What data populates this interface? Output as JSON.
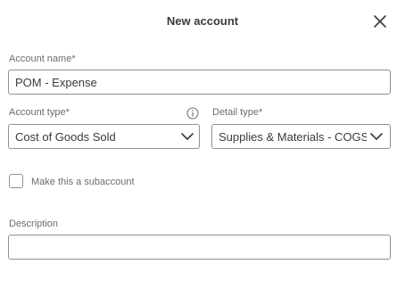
{
  "dialog": {
    "title": "New account"
  },
  "account_name": {
    "label": "Account name*",
    "value": "POM - Expense"
  },
  "account_type": {
    "label": "Account type*",
    "value": "Cost of Goods Sold"
  },
  "detail_type": {
    "label": "Detail type*",
    "value": "Supplies & Materials - COGS"
  },
  "subaccount": {
    "label": "Make this a subaccount",
    "checked": false
  },
  "description": {
    "label": "Description",
    "value": ""
  },
  "icons": {
    "close": "close-icon",
    "info": "info-icon",
    "chevron": "chevron-down-icon"
  }
}
